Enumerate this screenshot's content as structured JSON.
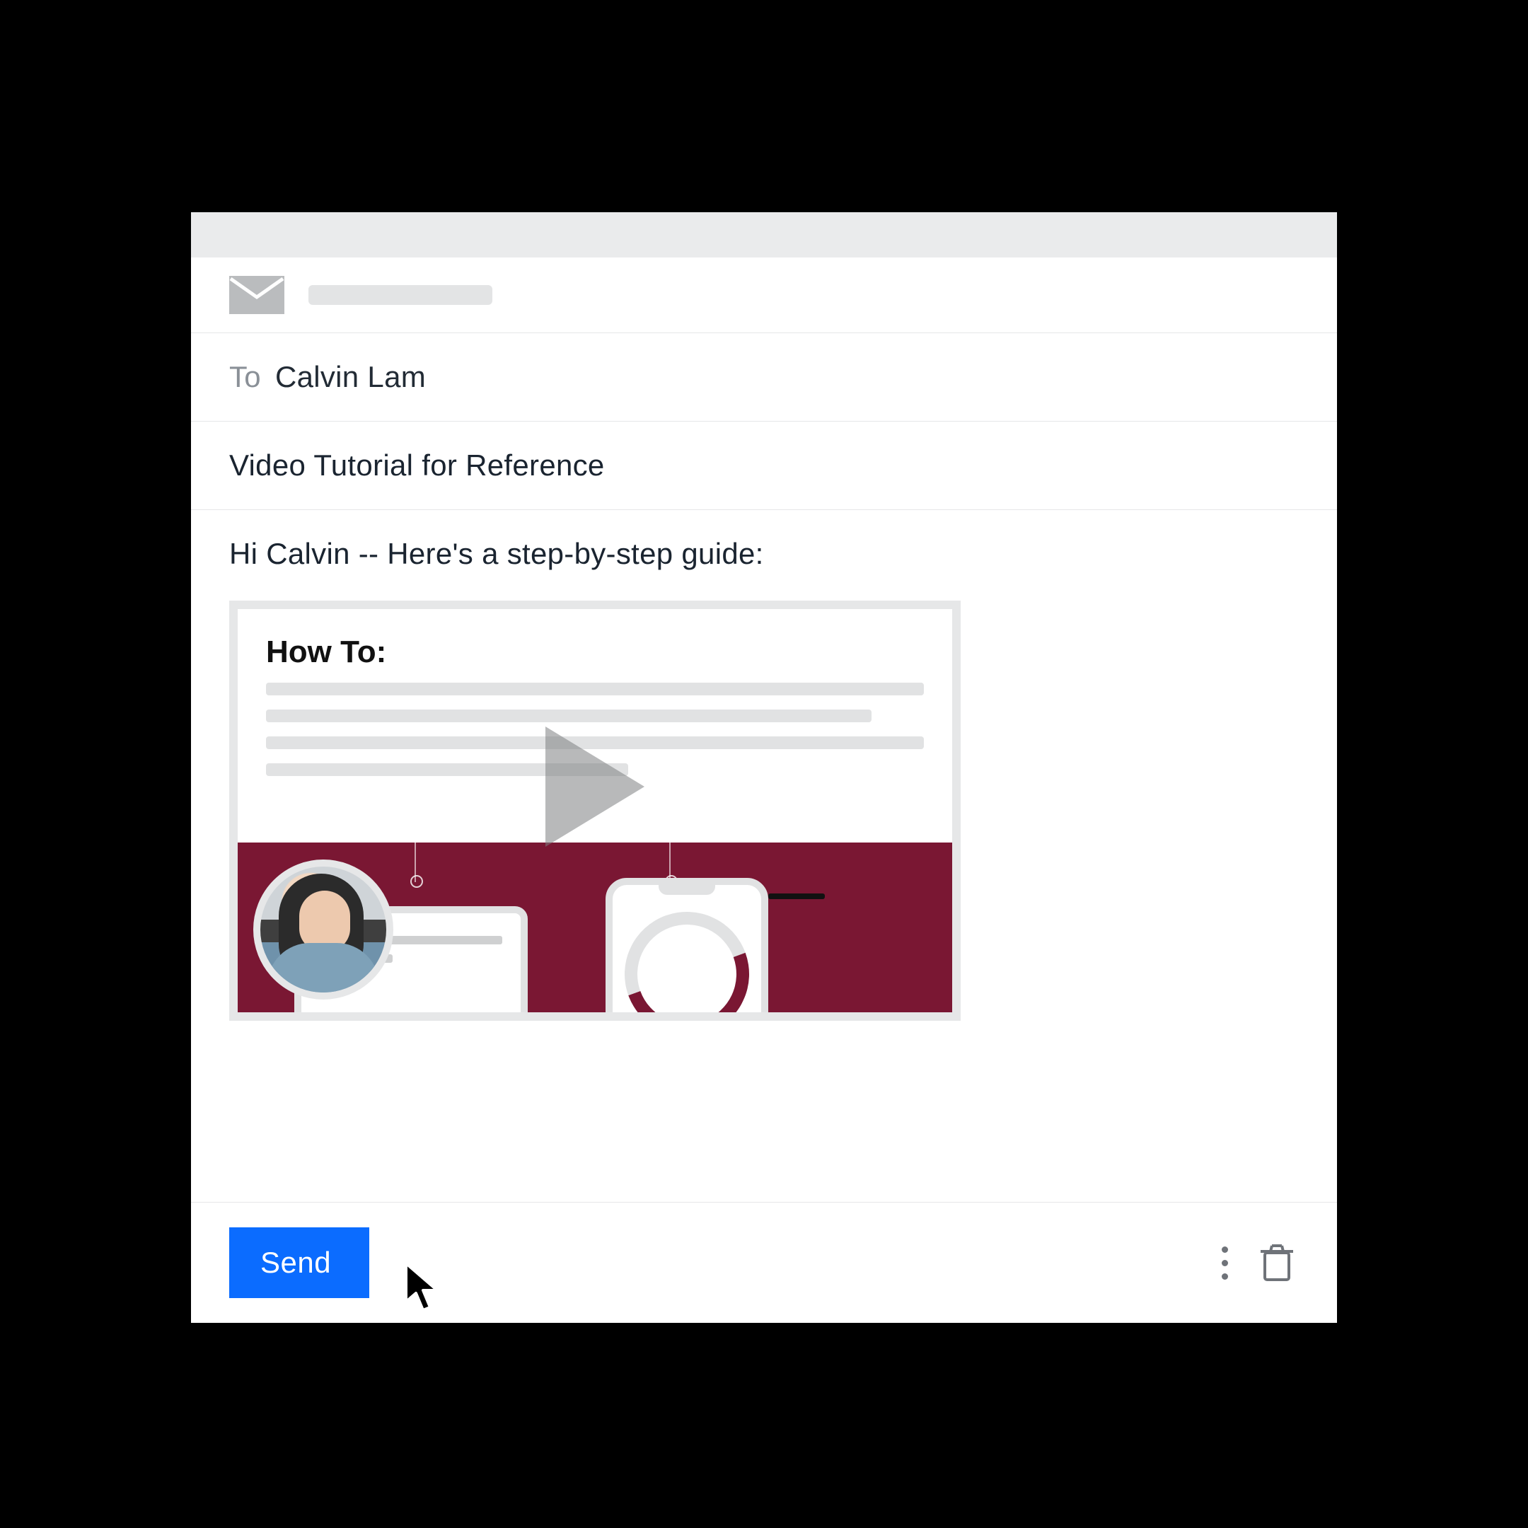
{
  "compose": {
    "to_label": "To",
    "recipient": "Calvin Lam",
    "subject": "Video Tutorial for Reference",
    "body": "Hi Calvin -- Here's a step-by-step guide:"
  },
  "video": {
    "title": "How To:"
  },
  "footer": {
    "send_label": "Send"
  },
  "icons": {
    "envelope": "envelope-icon",
    "more": "more-vertical-icon",
    "trash": "trash-icon",
    "play": "play-icon",
    "cursor": "cursor-icon"
  },
  "colors": {
    "primary": "#0b6cff",
    "band": "#7a1733"
  }
}
